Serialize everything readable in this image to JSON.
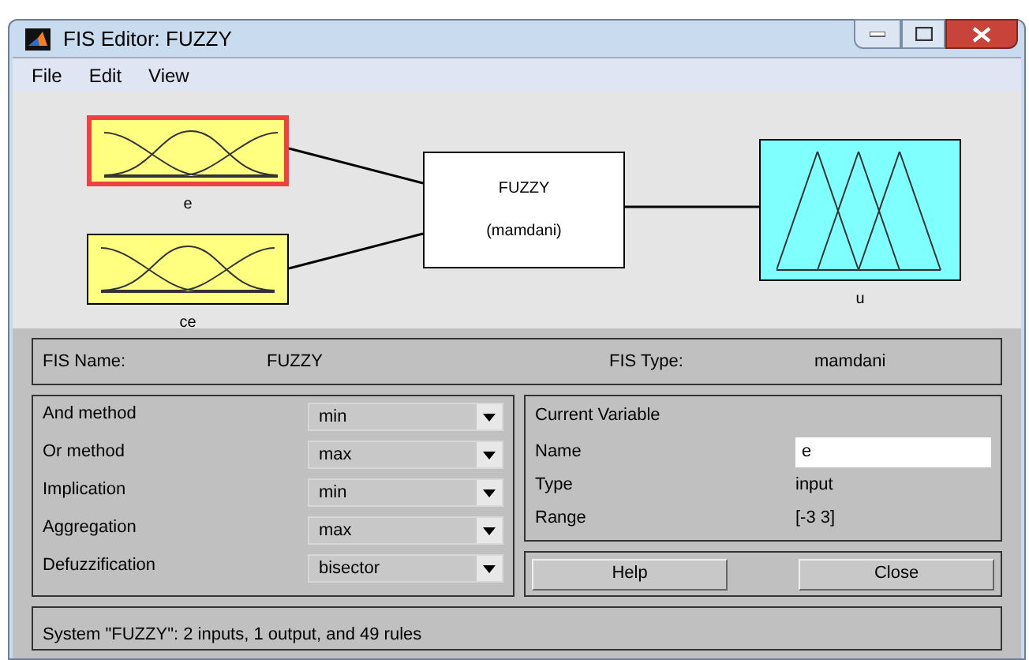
{
  "window": {
    "title": "FIS Editor: FUZZY"
  },
  "menu": [
    "File",
    "Edit",
    "View"
  ],
  "diagram": {
    "inputs": [
      {
        "label": "e",
        "selected": true
      },
      {
        "label": "ce",
        "selected": false
      }
    ],
    "system": {
      "name": "FUZZY",
      "type": "(mamdani)"
    },
    "outputs": [
      {
        "label": "u",
        "selected": false
      }
    ]
  },
  "fis_info": {
    "name_label": "FIS Name:",
    "name": "FUZZY",
    "type_label": "FIS Type:",
    "type": "mamdani"
  },
  "methods": [
    {
      "label": "And method",
      "value": "min"
    },
    {
      "label": "Or method",
      "value": "max"
    },
    {
      "label": "Implication",
      "value": "min"
    },
    {
      "label": "Aggregation",
      "value": "max"
    },
    {
      "label": "Defuzzification",
      "value": "bisector"
    }
  ],
  "current_variable": {
    "title": "Current Variable",
    "name_label": "Name",
    "name": "e",
    "type_label": "Type",
    "type": "input",
    "range_label": "Range",
    "range": "[-3 3]"
  },
  "buttons": [
    "Help",
    "Close"
  ],
  "status": "System \"FUZZY\": 2 inputs, 1 output, and 49 rules"
}
